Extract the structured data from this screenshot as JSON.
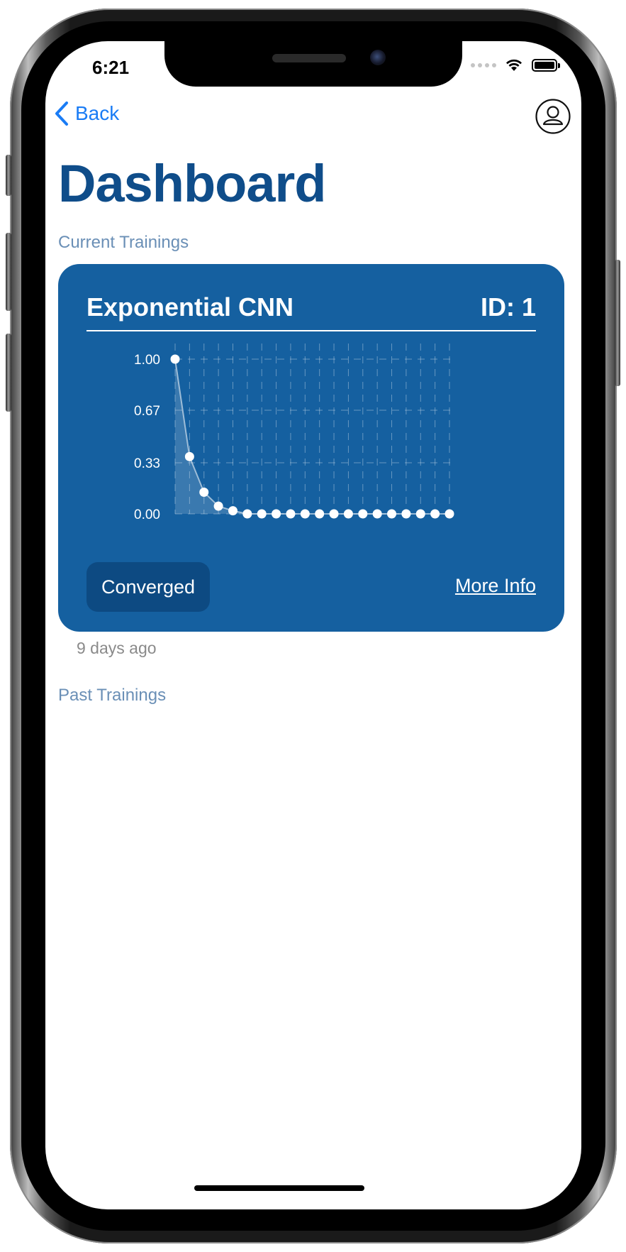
{
  "status_bar": {
    "time": "6:21"
  },
  "nav": {
    "back_label": "Back",
    "back_icon": "chevron-left-icon",
    "profile_icon": "person-circle-icon"
  },
  "page": {
    "title": "Dashboard",
    "current_section": "Current Trainings",
    "past_section": "Past Trainings"
  },
  "training_card": {
    "name": "Exponential CNN",
    "id_label": "ID: 1",
    "status": "Converged",
    "more_info": "More Info",
    "time_ago": "9 days ago"
  },
  "colors": {
    "accent": "#1a7cf5",
    "title": "#0f4d8a",
    "card_bg": "#1560a0",
    "pill_bg": "#0d4a82",
    "section_label": "#6a8fb6"
  },
  "chart_data": {
    "type": "line",
    "title": "",
    "xlabel": "",
    "ylabel": "",
    "ylim": [
      0,
      1
    ],
    "yticks": [
      "1.00",
      "0.67",
      "0.33",
      "0.00"
    ],
    "grid": true,
    "x": [
      1,
      2,
      3,
      4,
      5,
      6,
      7,
      8,
      9,
      10,
      11,
      12,
      13,
      14,
      15,
      16,
      17,
      18,
      19,
      20
    ],
    "series": [
      {
        "values": [
          1.0,
          0.37,
          0.14,
          0.05,
          0.02,
          0.0,
          0.0,
          0.0,
          0.0,
          0.0,
          0.0,
          0.0,
          0.0,
          0.0,
          0.0,
          0.0,
          0.0,
          0.0,
          0.0,
          0.0
        ]
      }
    ]
  }
}
